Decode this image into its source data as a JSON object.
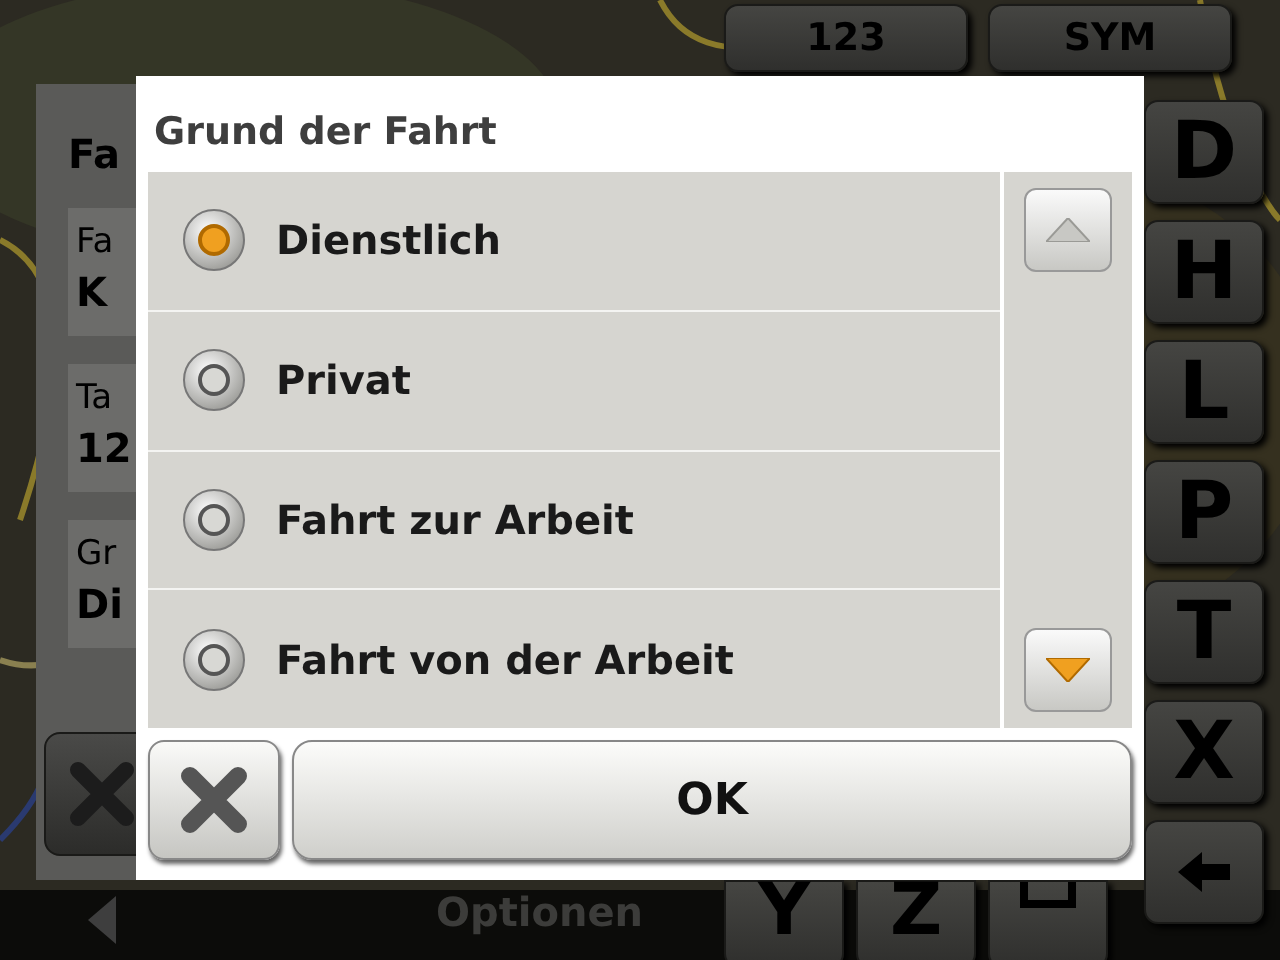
{
  "background": {
    "top_keys": [
      "123",
      "SYM"
    ],
    "side_keys": [
      "D",
      "H",
      "L",
      "P",
      "T",
      "X"
    ],
    "bottom_keys": [
      "Y",
      "Z"
    ],
    "panel": {
      "title": "Fa",
      "fields": [
        {
          "label": "Fa",
          "value": "K"
        },
        {
          "label": "Ta",
          "value": "12"
        },
        {
          "label": "Gr",
          "value": "Di"
        }
      ]
    },
    "footer_label": "Optionen"
  },
  "dialog": {
    "title": "Grund der Fahrt",
    "options": [
      {
        "label": "Dienstlich",
        "selected": true
      },
      {
        "label": "Privat",
        "selected": false
      },
      {
        "label": "Fahrt zur Arbeit",
        "selected": false
      },
      {
        "label": "Fahrt von der Arbeit",
        "selected": false
      }
    ],
    "ok_button": "OK"
  }
}
